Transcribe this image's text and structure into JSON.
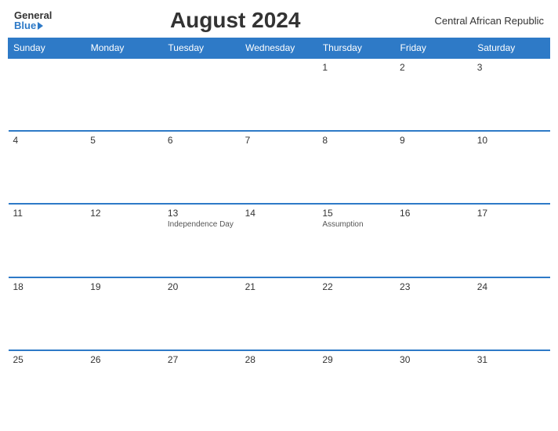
{
  "header": {
    "logo_general": "General",
    "logo_blue": "Blue",
    "title": "August 2024",
    "region": "Central African Republic"
  },
  "weekdays": [
    "Sunday",
    "Monday",
    "Tuesday",
    "Wednesday",
    "Thursday",
    "Friday",
    "Saturday"
  ],
  "weeks": [
    [
      {
        "day": "",
        "event": ""
      },
      {
        "day": "",
        "event": ""
      },
      {
        "day": "",
        "event": ""
      },
      {
        "day": "",
        "event": ""
      },
      {
        "day": "1",
        "event": ""
      },
      {
        "day": "2",
        "event": ""
      },
      {
        "day": "3",
        "event": ""
      }
    ],
    [
      {
        "day": "4",
        "event": ""
      },
      {
        "day": "5",
        "event": ""
      },
      {
        "day": "6",
        "event": ""
      },
      {
        "day": "7",
        "event": ""
      },
      {
        "day": "8",
        "event": ""
      },
      {
        "day": "9",
        "event": ""
      },
      {
        "day": "10",
        "event": ""
      }
    ],
    [
      {
        "day": "11",
        "event": ""
      },
      {
        "day": "12",
        "event": ""
      },
      {
        "day": "13",
        "event": "Independence Day"
      },
      {
        "day": "14",
        "event": ""
      },
      {
        "day": "15",
        "event": "Assumption"
      },
      {
        "day": "16",
        "event": ""
      },
      {
        "day": "17",
        "event": ""
      }
    ],
    [
      {
        "day": "18",
        "event": ""
      },
      {
        "day": "19",
        "event": ""
      },
      {
        "day": "20",
        "event": ""
      },
      {
        "day": "21",
        "event": ""
      },
      {
        "day": "22",
        "event": ""
      },
      {
        "day": "23",
        "event": ""
      },
      {
        "day": "24",
        "event": ""
      }
    ],
    [
      {
        "day": "25",
        "event": ""
      },
      {
        "day": "26",
        "event": ""
      },
      {
        "day": "27",
        "event": ""
      },
      {
        "day": "28",
        "event": ""
      },
      {
        "day": "29",
        "event": ""
      },
      {
        "day": "30",
        "event": ""
      },
      {
        "day": "31",
        "event": ""
      }
    ]
  ]
}
